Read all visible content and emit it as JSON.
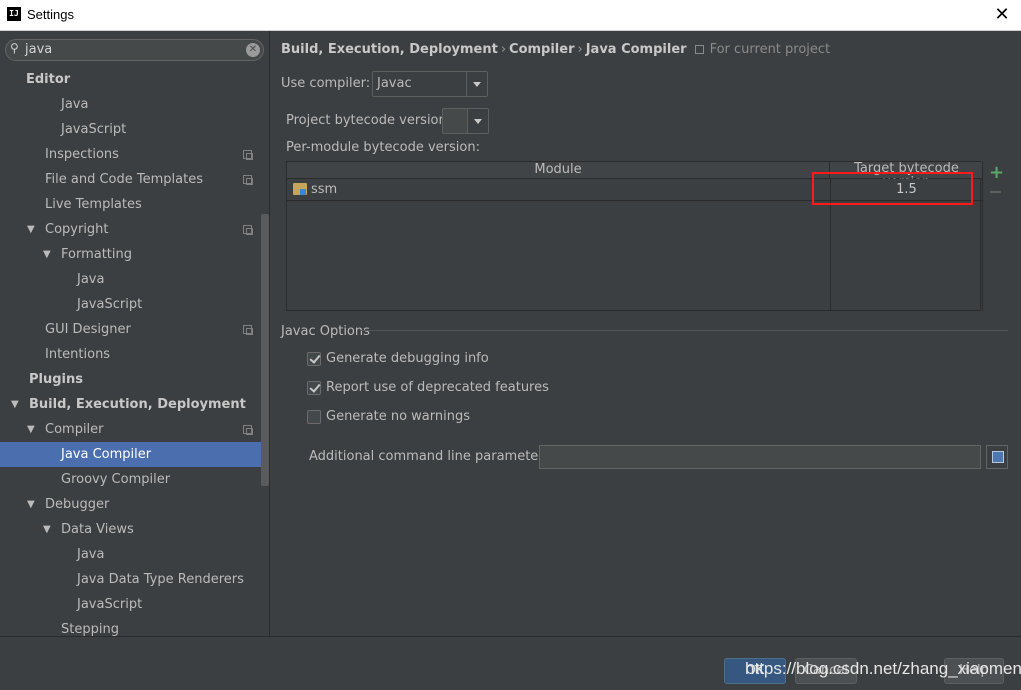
{
  "window": {
    "title": "Settings",
    "app_icon_text": "IJ",
    "close_glyph": "✕"
  },
  "search": {
    "value": "java",
    "icon": "search-icon",
    "clear_glyph": "✕"
  },
  "tree": [
    {
      "label": "Editor",
      "bold": true
    },
    {
      "label": "Java"
    },
    {
      "label": "JavaScript"
    },
    {
      "label": "Inspections",
      "copy": true
    },
    {
      "label": "File and Code Templates",
      "copy": true
    },
    {
      "label": "Live Templates"
    },
    {
      "label": "Copyright",
      "expanded": true,
      "copy": true
    },
    {
      "label": "Formatting",
      "expanded": true
    },
    {
      "label": "Java"
    },
    {
      "label": "JavaScript"
    },
    {
      "label": "GUI Designer",
      "copy": true
    },
    {
      "label": "Intentions"
    },
    {
      "label": "Plugins",
      "bold": true
    },
    {
      "label": "Build, Execution, Deployment",
      "bold": true,
      "expanded": true
    },
    {
      "label": "Compiler",
      "expanded": true,
      "copy": true
    },
    {
      "label": "Java Compiler",
      "selected": true
    },
    {
      "label": "Groovy Compiler"
    },
    {
      "label": "Debugger",
      "expanded": true
    },
    {
      "label": "Data Views",
      "expanded": true
    },
    {
      "label": "Java"
    },
    {
      "label": "Java Data Type Renderers"
    },
    {
      "label": "JavaScript"
    },
    {
      "label": "Stepping"
    }
  ],
  "breadcrumb": {
    "items": [
      "Build, Execution, Deployment",
      "Compiler",
      "Java Compiler"
    ],
    "separator": "›",
    "scope": "For current project"
  },
  "compiler": {
    "use_compiler_label": "Use compiler:",
    "use_compiler_value": "Javac",
    "bytecode_label": "Project bytecode version:",
    "bytecode_value": "",
    "per_module_label": "Per-module bytecode version:"
  },
  "module_table": {
    "columns": [
      "Module",
      "Target bytecode version"
    ],
    "rows": [
      {
        "module": "ssm",
        "target": "1.5"
      }
    ],
    "add_glyph": "+"
  },
  "javac": {
    "section_title": "Javac Options",
    "options": [
      {
        "label": "Generate debugging info",
        "checked": true
      },
      {
        "label": "Report use of deprecated features",
        "checked": true
      },
      {
        "label": "Generate no warnings",
        "checked": false
      }
    ],
    "params_label": "Additional command line parameters:",
    "params_value": ""
  },
  "buttons": {
    "ok": "OK",
    "cancel": "Cancel",
    "help": "Help"
  },
  "watermark": "https://blog.csdn.net/zhang_xiaomeng",
  "colors": {
    "selection": "#4b6eaf",
    "add_green": "#59a869",
    "highlight_red": "#ff1a1a",
    "background": "#3c3f41"
  }
}
